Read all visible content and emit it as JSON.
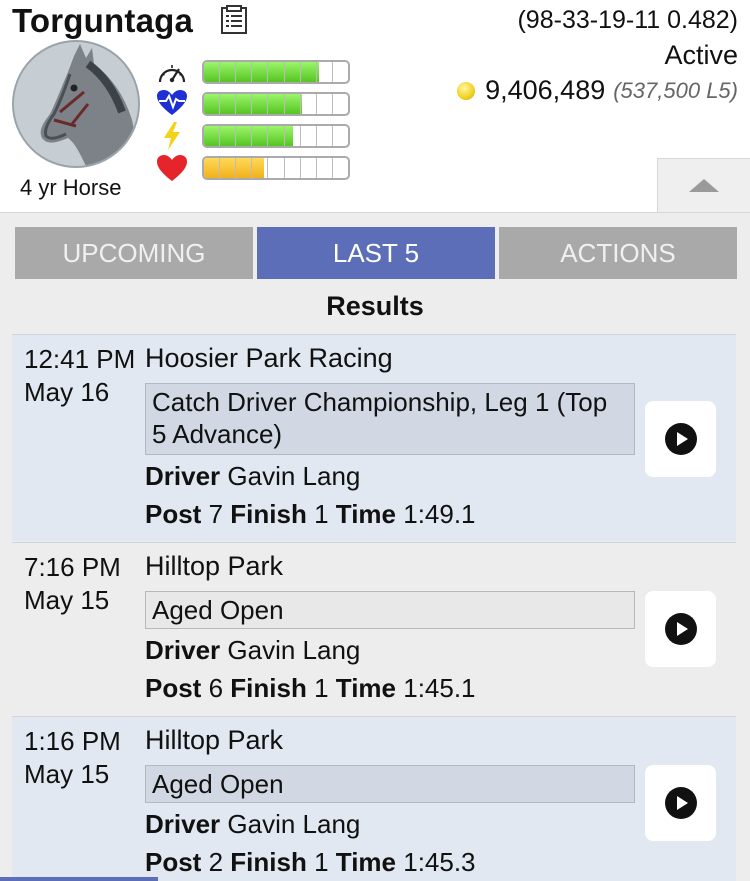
{
  "horse": {
    "name": "Torguntaga",
    "record": "(98-33-19-11 0.482)",
    "status": "Active",
    "earnings": "9,406,489",
    "earnings_l5": "(537,500 L5)",
    "age_label": "4 yr Horse"
  },
  "stats": [
    {
      "name": "speed",
      "icon": "speedometer-icon",
      "fraction": 0.8,
      "color": "green"
    },
    {
      "name": "stamina",
      "icon": "heartbeat-icon",
      "fraction": 0.68,
      "color": "green"
    },
    {
      "name": "energy",
      "icon": "lightning-icon",
      "fraction": 0.62,
      "color": "green"
    },
    {
      "name": "health",
      "icon": "heart-icon",
      "fraction": 0.42,
      "color": "yellow"
    }
  ],
  "tabs": [
    {
      "label": "UPCOMING",
      "active": false
    },
    {
      "label": "LAST 5",
      "active": true
    },
    {
      "label": "ACTIONS",
      "active": false
    }
  ],
  "section_title": "Results",
  "labels": {
    "driver": "Driver",
    "post": "Post",
    "finish": "Finish",
    "time": "Time"
  },
  "races": [
    {
      "when": "12:41 PM May 16",
      "track": "Hoosier Park Racing",
      "event": "Catch Driver Championship, Leg 1 (Top 5 Advance)",
      "driver": "Gavin Lang",
      "post": "7",
      "finish": "1",
      "time": "1:49.1"
    },
    {
      "when": "7:16 PM May 15",
      "track": "Hilltop Park",
      "event": "Aged Open",
      "driver": "Gavin Lang",
      "post": "6",
      "finish": "1",
      "time": "1:45.1"
    },
    {
      "when": "1:16 PM May 15",
      "track": "Hilltop Park",
      "event": "Aged Open",
      "driver": "Gavin Lang",
      "post": "2",
      "finish": "1",
      "time": "1:45.3"
    }
  ],
  "colors": {
    "accent": "#5c6eb7",
    "bar_green": "#55c523",
    "bar_yellow": "#f1b21a",
    "race_bg_odd": "#e1e8f1"
  }
}
